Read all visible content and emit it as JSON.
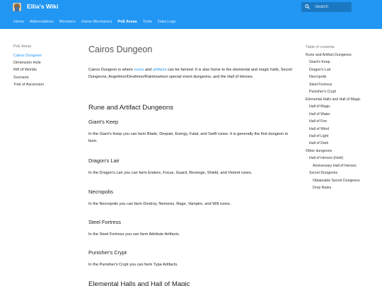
{
  "header": {
    "site_title": "Ellia's Wiki",
    "logo_icon": "wizard-avatar-icon",
    "search_placeholder": "Search",
    "search_icon": "search-icon",
    "background_color": "#2196f3",
    "tabs": [
      {
        "label": "Home"
      },
      {
        "label": "Abbreviations"
      },
      {
        "label": "Monsters"
      },
      {
        "label": "Game Mechanics"
      },
      {
        "label": "PvE Areas"
      },
      {
        "label": "Tools"
      },
      {
        "label": "Data Logs"
      }
    ],
    "active_tab": "PvE Areas"
  },
  "left_nav": {
    "section": "PvE Areas",
    "items": [
      {
        "label": "Cairos Dungeon"
      },
      {
        "label": "Dimension Hole"
      },
      {
        "label": "Rift of Worlds"
      },
      {
        "label": "Scenario"
      },
      {
        "label": "Trial of Ascension"
      }
    ],
    "active_item": "Cairos Dungeon",
    "accent_color": "#2196f3"
  },
  "content": {
    "title": "Cairos Dungeon",
    "intro": {
      "part1": "Cairos Dungeon is where ",
      "link1": "runes",
      "part2": " and ",
      "link2": "artifacts",
      "part3": " can be farmed. It is also home to the elemental and magic halls, Secret Dungeons, Angelmon/Devilmon/Rainbowmon special event dungeons, and the Hall of Heroes."
    },
    "h2_1": "Rune and Artifact Dungeons",
    "sections": [
      {
        "heading": "Giant's Keep",
        "text": "In the Giant's Keep you can farm Blade, Despair, Energy, Fatal, and Swift runes. It is generally the first dungeon to farm."
      },
      {
        "heading": "Dragon's Lair",
        "text": "In the Dragon's Lair you can farm Endure, Focus, Guard, Revenge, Shield, and Violent runes."
      },
      {
        "heading": "Necropolis",
        "text": "In the Necropolis you can farm Destroy, Nemesis, Rage, Vampire, and Will runes."
      },
      {
        "heading": "Steel Fortress",
        "text": "In the Steel Fortress you can farm Attribute Artifacts."
      },
      {
        "heading": "Punisher's Crypt",
        "text": "In the Punisher's Crypt you can farm Type Artifacts."
      }
    ],
    "h2_2": "Elemental Halls and Hall of Magic"
  },
  "toc": {
    "title": "Table of contents",
    "items": [
      {
        "label": "Rune and Artifact Dungeons",
        "level": 1
      },
      {
        "label": "Giant's Keep",
        "level": 2
      },
      {
        "label": "Dragon's Lair",
        "level": 2
      },
      {
        "label": "Necropolis",
        "level": 2
      },
      {
        "label": "Steel Fortress",
        "level": 2
      },
      {
        "label": "Punisher's Crypt",
        "level": 2
      },
      {
        "label": "Elemental Halls and Hall of Magic",
        "level": 1
      },
      {
        "label": "Hall of Magic",
        "level": 2
      },
      {
        "label": "Hall of Water",
        "level": 2
      },
      {
        "label": "Hall of Fire",
        "level": 2
      },
      {
        "label": "Hall of Wind",
        "level": 2
      },
      {
        "label": "Hall of Light",
        "level": 2
      },
      {
        "label": "Hall of Dark",
        "level": 2
      },
      {
        "label": "Other dungeons",
        "level": 1
      },
      {
        "label": "Hall of Heroes (HoH)",
        "level": 2
      },
      {
        "label": "Anniversary Hall of Heroes",
        "level": 3
      },
      {
        "label": "Secret Dungeons",
        "level": 2
      },
      {
        "label": "Obtainable Secret Dungeons",
        "level": 3
      },
      {
        "label": "Drop Rates",
        "level": 3
      }
    ]
  }
}
